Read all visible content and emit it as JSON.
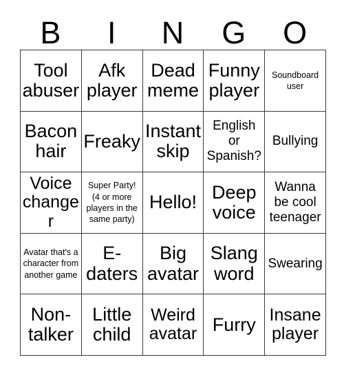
{
  "card": {
    "header_letters": [
      "B",
      "I",
      "N",
      "G",
      "O"
    ],
    "rows": [
      [
        {
          "text": "Tool abuser",
          "size": "xl"
        },
        {
          "text": "Afk player",
          "size": "xl"
        },
        {
          "text": "Dead meme",
          "size": "xl"
        },
        {
          "text": "Funny player",
          "size": "xl"
        },
        {
          "text": "Soundboard user",
          "size": "xs"
        }
      ],
      [
        {
          "text": "Bacon hair",
          "size": "xl"
        },
        {
          "text": "Freaky",
          "size": "xl"
        },
        {
          "text": "Instant skip",
          "size": "xl"
        },
        {
          "text": "English or Spanish?",
          "size": "md"
        },
        {
          "text": "Bullying",
          "size": "md"
        }
      ],
      [
        {
          "text": "Voice changer",
          "size": "lg"
        },
        {
          "text": "Super Party! (4 or more players in the same party)",
          "size": "xs"
        },
        {
          "text": "Hello!",
          "size": "xl"
        },
        {
          "text": "Deep voice",
          "size": "xl"
        },
        {
          "text": "Wanna be cool teenager",
          "size": "md"
        }
      ],
      [
        {
          "text": "Avatar that's a character from another game",
          "size": "xs"
        },
        {
          "text": "E-daters",
          "size": "xl"
        },
        {
          "text": "Big avatar",
          "size": "xl"
        },
        {
          "text": "Slang word",
          "size": "xl"
        },
        {
          "text": "Swearing",
          "size": "md"
        }
      ],
      [
        {
          "text": "Non-talker",
          "size": "xl"
        },
        {
          "text": "Little child",
          "size": "xl"
        },
        {
          "text": "Weird avatar",
          "size": "lg"
        },
        {
          "text": "Furry",
          "size": "xl"
        },
        {
          "text": "Insane player",
          "size": "lg"
        }
      ]
    ]
  },
  "colors": {
    "background": "#ffffff",
    "text": "#000000",
    "grid_line": "#3a3a3a"
  }
}
